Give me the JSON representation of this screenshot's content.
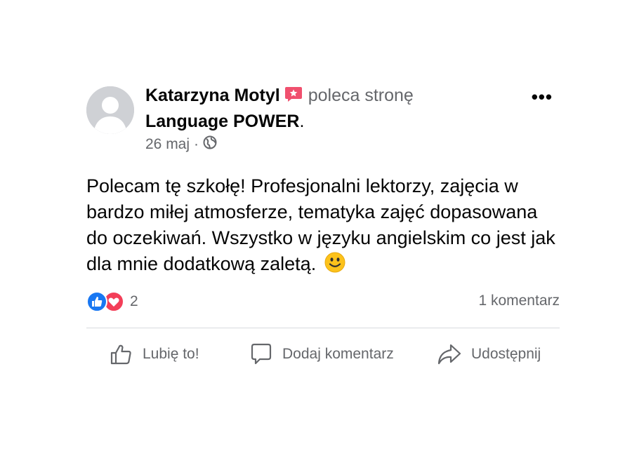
{
  "post": {
    "author": "Katarzyna Motyl",
    "recommends_text": "poleca stronę",
    "page_name": "Language POWER",
    "period": ".",
    "date": "26 maj",
    "separator": "·",
    "more_label": "•••",
    "body": "Polecam tę szkołę! Profesjonalni lektorzy, zajęcia w bardzo miłej atmosferze, tematyka zajęć dopasowana do oczekiwań. Wszystko w języku angielskim co jest jak dla mnie dodatkową zaletą.",
    "reaction_count": "2",
    "comments_label": "1 komentarz"
  },
  "actions": {
    "like": "Lubię to!",
    "comment": "Dodaj komentarz",
    "share": "Udostępnij"
  },
  "colors": {
    "like_blue": "#1877f2",
    "love_red": "#f33e58",
    "recommend_red": "#f0506e",
    "secondary_text": "#65676b"
  }
}
